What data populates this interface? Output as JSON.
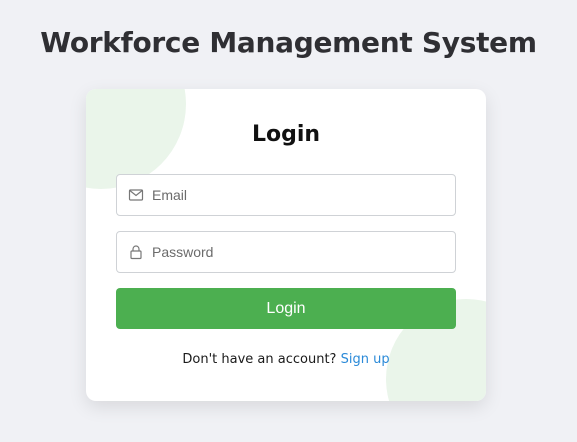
{
  "app": {
    "title": "Workforce Management System"
  },
  "login_card": {
    "title": "Login",
    "email": {
      "placeholder": "Email",
      "value": "",
      "icon": "mail-icon"
    },
    "password": {
      "placeholder": "Password",
      "value": "",
      "icon": "lock-icon"
    },
    "submit_label": "Login",
    "signup_prompt": "Don't have an account?",
    "signup_link": "Sign up"
  },
  "colors": {
    "background": "#f0f1f5",
    "accent": "#4caf50",
    "link": "#2b8ad8",
    "decoration": "#eaf5ea"
  }
}
